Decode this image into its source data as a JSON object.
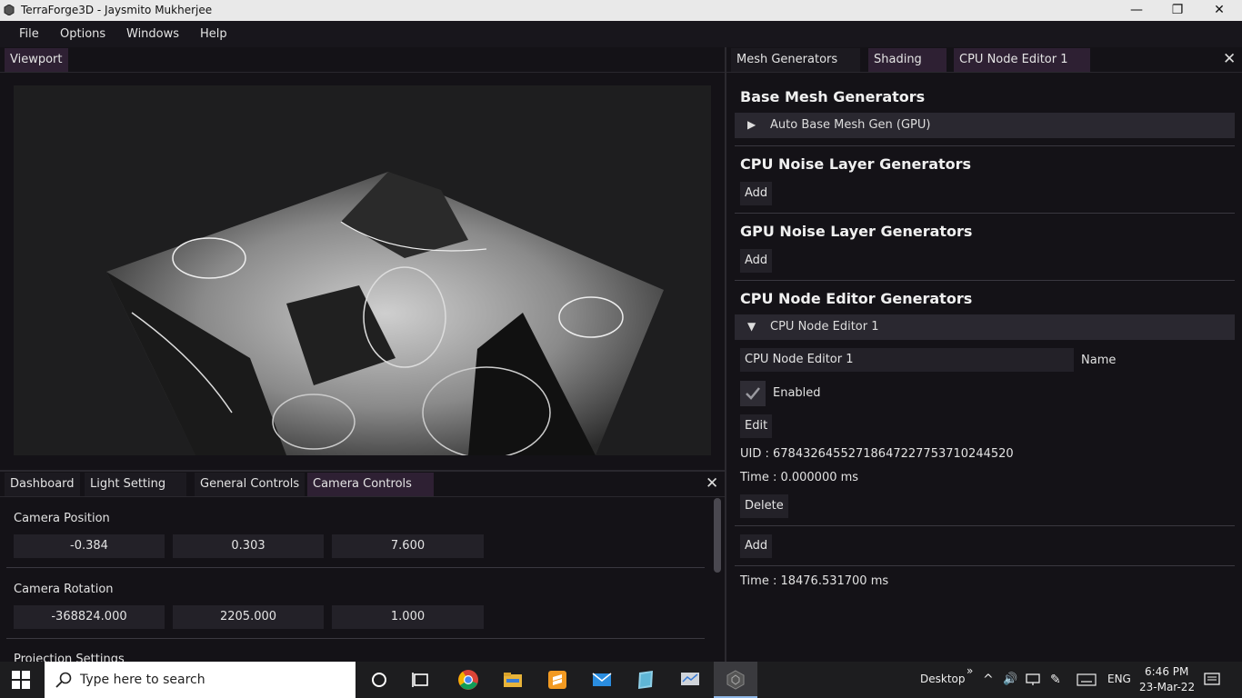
{
  "window": {
    "title": "TerraForge3D - Jaysmito Mukherjee",
    "minimize": "—",
    "restore": "❐",
    "close": "✕"
  },
  "menu": [
    "File",
    "Options",
    "Windows",
    "Help"
  ],
  "viewport": {
    "tab": "Viewport"
  },
  "bottom_panel": {
    "tabs": [
      "Dashboard",
      "Light Setting",
      "General Controls",
      "Camera Controls"
    ],
    "active_tab": "Camera Controls",
    "close": "✕",
    "camera_position": {
      "label": "Camera Position",
      "values": [
        "-0.384",
        "0.303",
        "7.600"
      ]
    },
    "camera_rotation": {
      "label": "Camera Rotation",
      "values": [
        "-368824.000",
        "2205.000",
        "1.000"
      ]
    },
    "projection_label": "Projection Settings"
  },
  "right_panel": {
    "tabs": [
      "Mesh Generators",
      "Shading",
      "CPU Node Editor 1"
    ],
    "close": "✕",
    "base_mesh": {
      "header": "Base Mesh Generators",
      "item": "Auto Base Mesh Gen (GPU)",
      "arrow": "▶"
    },
    "cpu_noise": {
      "header": "CPU Noise Layer Generators",
      "add": "Add"
    },
    "gpu_noise": {
      "header": "GPU Noise Layer Generators",
      "add": "Add"
    },
    "cpu_node": {
      "header": "CPU Node Editor Generators",
      "item": "CPU Node Editor 1",
      "arrow": "▼",
      "name_value": "CPU Node Editor 1",
      "name_label": "Name",
      "enabled_label": "Enabled",
      "enabled": true,
      "edit": "Edit",
      "uid": "UID : 67843264552718647227753710244520",
      "time": "Time : 0.000000 ms",
      "delete": "Delete",
      "add": "Add"
    },
    "total_time": "Time : 18476.531700 ms"
  },
  "taskbar": {
    "search_placeholder": "Type here to search",
    "desktop_label": "Desktop",
    "chevron": "»",
    "lang": "ENG",
    "time": "6:46 PM",
    "date": "23-Mar-22"
  }
}
